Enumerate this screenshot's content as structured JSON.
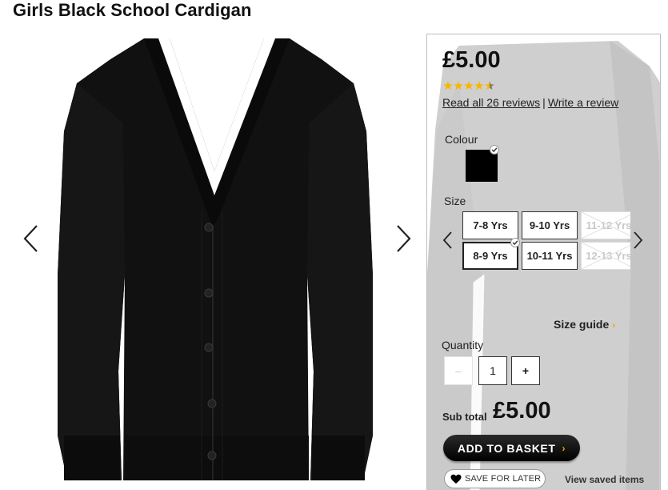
{
  "product": {
    "title": "Girls Black School Cardigan",
    "price": "£5.00",
    "rating": 4.5,
    "rating_max": 5,
    "reviews_link": "Read all 26 reviews",
    "reviews_separator": "|",
    "write_review_link": "Write a review"
  },
  "colour": {
    "label": "Colour",
    "selected_swatch": "#000000"
  },
  "size": {
    "label": "Size",
    "options": [
      {
        "label": "7-8 Yrs",
        "state": "available"
      },
      {
        "label": "8-9 Yrs",
        "state": "selected"
      },
      {
        "label": "9-10 Yrs",
        "state": "available"
      },
      {
        "label": "10-11 Yrs",
        "state": "available"
      },
      {
        "label": "11-12 Yrs",
        "state": "unavailable"
      },
      {
        "label": "12-13 Yrs",
        "state": "unavailable"
      }
    ],
    "guide_label": "Size guide",
    "guide_chevron": "›"
  },
  "quantity": {
    "label": "Quantity",
    "minus": "–",
    "value": "1",
    "plus": "+"
  },
  "subtotal": {
    "label": "Sub total",
    "value": "£5.00"
  },
  "actions": {
    "add_to_basket": "ADD TO BASKET",
    "add_chevron": "›",
    "save_for_later": "SAVE FOR LATER",
    "view_saved": "View saved items"
  },
  "icons": {
    "prev": "chevron-left-icon",
    "next": "chevron-right-icon",
    "star": "star-icon",
    "check": "check-icon",
    "heart": "heart-icon"
  },
  "colors": {
    "star": "#f5b800",
    "accent_chevron": "#f2a900",
    "button_bg": "#000000"
  }
}
